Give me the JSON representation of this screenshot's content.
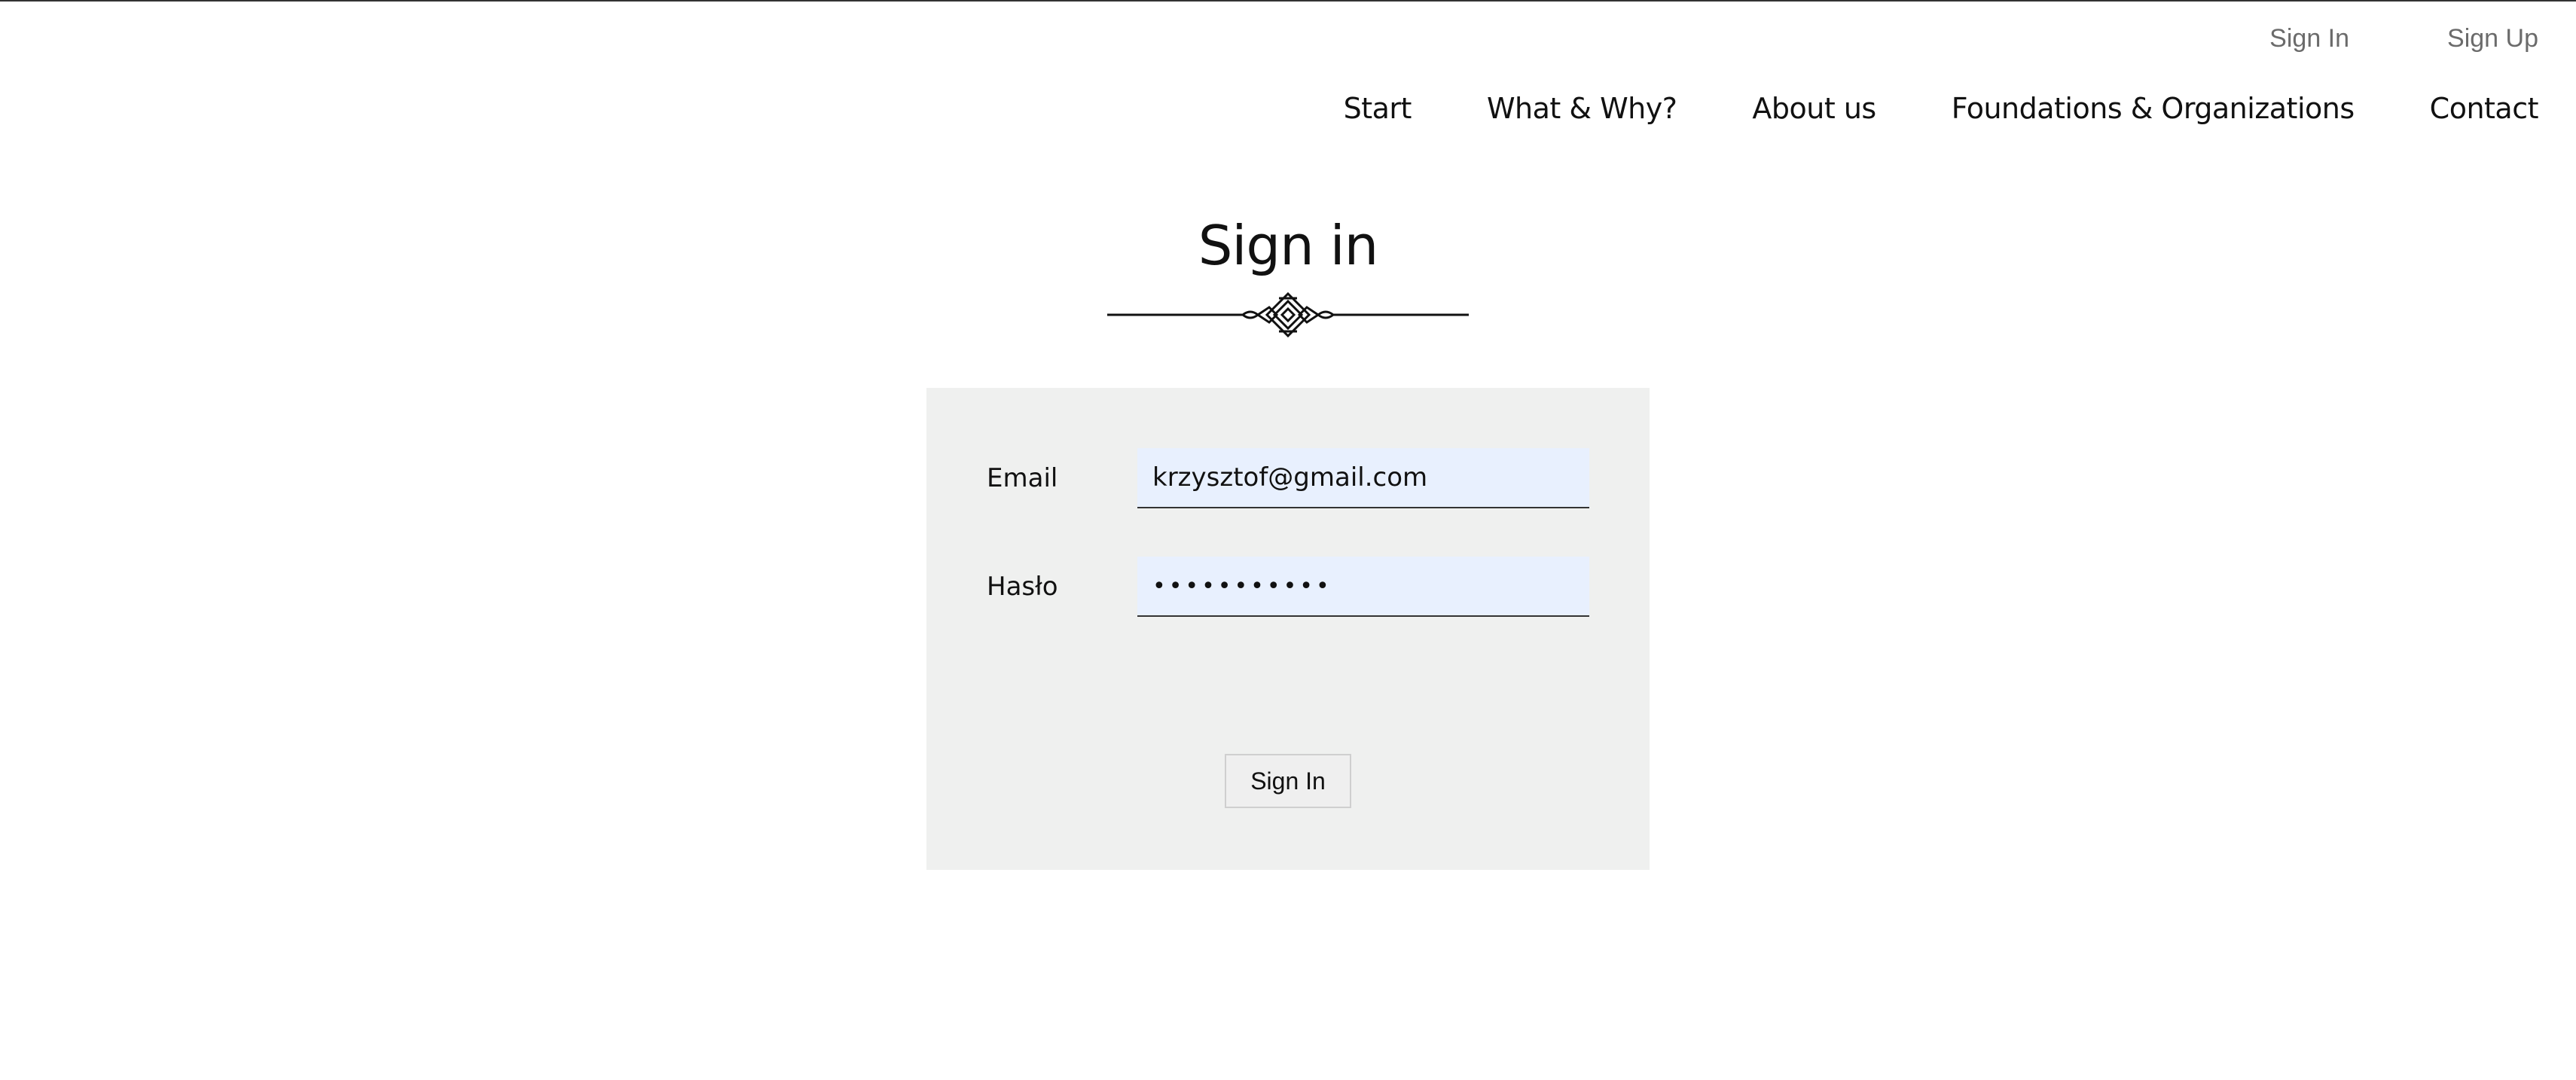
{
  "auth_links": {
    "sign_in": "Sign In",
    "sign_up": "Sign Up"
  },
  "nav": {
    "items": [
      {
        "label": "Start"
      },
      {
        "label": "What & Why?"
      },
      {
        "label": "About us"
      },
      {
        "label": "Foundations & Organizations"
      },
      {
        "label": "Contact"
      }
    ]
  },
  "page": {
    "title": "Sign in"
  },
  "form": {
    "email_label": "Email",
    "email_value": "krzysztof@gmail.com",
    "password_label": "Hasło",
    "password_value": "•••••••••••",
    "submit_label": "Sign In"
  },
  "colors": {
    "panel_background": "#eff0ef",
    "input_autofill": "#e8f0fe",
    "link_gray": "#6b6b6b"
  },
  "icons": {
    "title_decoration": "ornament-divider-icon"
  }
}
